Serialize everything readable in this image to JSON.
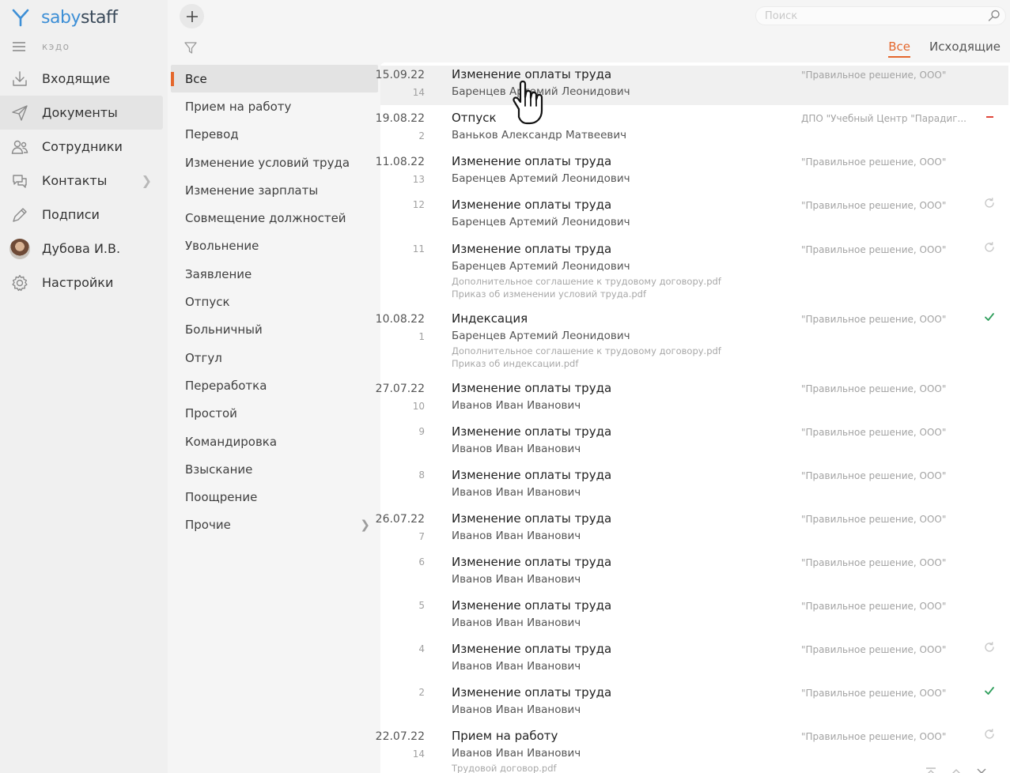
{
  "app": {
    "brand_part1": "saby",
    "brand_part2": "staff",
    "section_label": "кэдо"
  },
  "nav": [
    {
      "label": "Входящие",
      "icon": "inbox-icon"
    },
    {
      "label": "Документы",
      "icon": "send-icon",
      "active": true
    },
    {
      "label": "Сотрудники",
      "icon": "employees-icon"
    },
    {
      "label": "Контакты",
      "icon": "chat-icon",
      "has_chevron": true
    },
    {
      "label": "Подписи",
      "icon": "pen-icon"
    },
    {
      "label": "Дубова И.В.",
      "icon": "avatar"
    },
    {
      "label": "Настройки",
      "icon": "gear-icon"
    }
  ],
  "filters": [
    {
      "label": "Все",
      "active": true
    },
    {
      "label": "Прием на работу"
    },
    {
      "label": "Перевод"
    },
    {
      "label": "Изменение условий труда"
    },
    {
      "label": "Изменение зарплаты"
    },
    {
      "label": "Совмещение должностей"
    },
    {
      "label": "Увольнение"
    },
    {
      "label": "Заявление"
    },
    {
      "label": "Отпуск"
    },
    {
      "label": "Больничный"
    },
    {
      "label": "Отгул"
    },
    {
      "label": "Переработка"
    },
    {
      "label": "Простой"
    },
    {
      "label": "Командировка"
    },
    {
      "label": "Взыскание"
    },
    {
      "label": "Поощрение"
    },
    {
      "label": "Прочие",
      "has_chevron": true
    }
  ],
  "search": {
    "placeholder": "Поиск",
    "value": ""
  },
  "tabs": [
    {
      "label": "Все",
      "active": true
    },
    {
      "label": "Исходящие"
    }
  ],
  "documents": [
    {
      "date": "15.09.22",
      "number": "14",
      "title": "Изменение оплаты труда",
      "person": "Баренцев Артемий Леонидович",
      "org": "\"Правильное решение, ООО\"",
      "status": "none",
      "hover": true,
      "attachments": []
    },
    {
      "date": "19.08.22",
      "number": "2",
      "title": "Отпуск",
      "person": "Ваньков Александр Матвеевич",
      "org": "ДПО \"Учебный Центр \"Парадиг...",
      "status": "rejected",
      "attachments": []
    },
    {
      "date": "11.08.22",
      "number": "13",
      "title": "Изменение оплаты труда",
      "person": "Баренцев Артемий Леонидович",
      "org": "\"Правильное решение, ООО\"",
      "status": "none",
      "attachments": []
    },
    {
      "date": "",
      "number": "12",
      "title": "Изменение оплаты труда",
      "person": "Баренцев Артемий Леонидович",
      "org": "\"Правильное решение, ООО\"",
      "status": "in-progress",
      "attachments": []
    },
    {
      "date": "",
      "number": "11",
      "title": "Изменение оплаты труда",
      "person": "Баренцев Артемий Леонидович",
      "org": "\"Правильное решение, ООО\"",
      "status": "in-progress",
      "attachments": [
        "Дополнительное соглашение к трудовому договору.pdf",
        "Приказ об изменении условий труда.pdf"
      ]
    },
    {
      "date": "10.08.22",
      "number": "1",
      "title": "Индексация",
      "person": "Баренцев Артемий Леонидович",
      "org": "\"Правильное решение, ООО\"",
      "status": "done",
      "attachments": [
        "Дополнительное соглашение к трудовому договору.pdf",
        "Приказ об индексации.pdf"
      ]
    },
    {
      "date": "27.07.22",
      "number": "10",
      "title": "Изменение оплаты труда",
      "person": "Иванов Иван Иванович",
      "org": "\"Правильное решение, ООО\"",
      "status": "none",
      "attachments": []
    },
    {
      "date": "",
      "number": "9",
      "title": "Изменение оплаты труда",
      "person": "Иванов Иван Иванович",
      "org": "\"Правильное решение, ООО\"",
      "status": "none",
      "attachments": []
    },
    {
      "date": "",
      "number": "8",
      "title": "Изменение оплаты труда",
      "person": "Иванов Иван Иванович",
      "org": "\"Правильное решение, ООО\"",
      "status": "none",
      "attachments": []
    },
    {
      "date": "26.07.22",
      "number": "7",
      "title": "Изменение оплаты труда",
      "person": "Иванов Иван Иванович",
      "org": "\"Правильное решение, ООО\"",
      "status": "none",
      "attachments": []
    },
    {
      "date": "",
      "number": "6",
      "title": "Изменение оплаты труда",
      "person": "Иванов Иван Иванович",
      "org": "\"Правильное решение, ООО\"",
      "status": "none",
      "attachments": []
    },
    {
      "date": "",
      "number": "5",
      "title": "Изменение оплаты труда",
      "person": "Иванов Иван Иванович",
      "org": "\"Правильное решение, ООО\"",
      "status": "none",
      "attachments": []
    },
    {
      "date": "",
      "number": "4",
      "title": "Изменение оплаты труда",
      "person": "Иванов Иван Иванович",
      "org": "\"Правильное решение, ООО\"",
      "status": "in-progress",
      "attachments": []
    },
    {
      "date": "",
      "number": "2",
      "title": "Изменение оплаты труда",
      "person": "Иванов Иван Иванович",
      "org": "\"Правильное решение, ООО\"",
      "status": "done",
      "attachments": []
    },
    {
      "date": "22.07.22",
      "number": "14",
      "title": "Прием на работу",
      "person": "Иванов Иван Иванович",
      "org": "\"Правильное решение, ООО\"",
      "status": "in-progress",
      "attachments": [
        "Трудовой договор.pdf"
      ]
    }
  ],
  "colors": {
    "accent": "#e4672c",
    "done": "#2e9e5b",
    "rejected": "#e0453a",
    "brand_blue": "#3d8fd6"
  }
}
